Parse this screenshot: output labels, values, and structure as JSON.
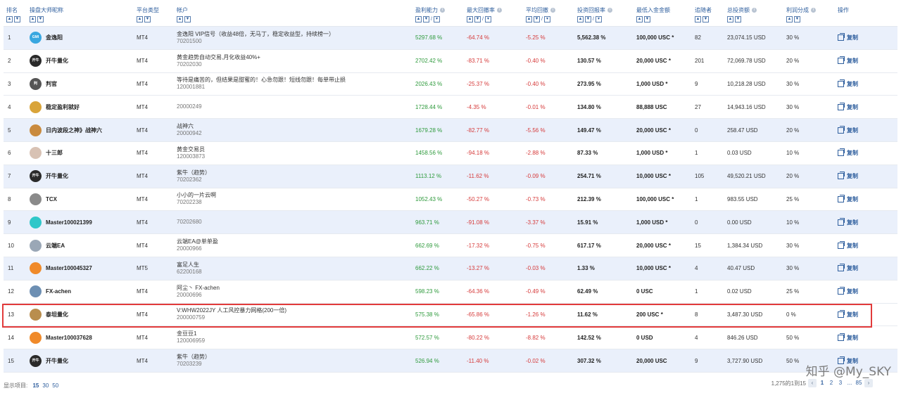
{
  "headers": [
    {
      "label": "排名",
      "info": false
    },
    {
      "label": "操盘大师昵称",
      "info": false
    },
    {
      "label": "平台类型",
      "info": false
    },
    {
      "label": "帐户",
      "info": false
    },
    {
      "label": "盈利能力",
      "info": true
    },
    {
      "label": "最大回撤率",
      "info": true
    },
    {
      "label": "平均回撤",
      "info": true
    },
    {
      "label": "投资回报率",
      "info": true
    },
    {
      "label": "最低入金金额",
      "info": false
    },
    {
      "label": "追随者",
      "info": false
    },
    {
      "label": "总投资额",
      "info": true
    },
    {
      "label": "利润分成",
      "info": true
    },
    {
      "label": "操作",
      "info": false
    }
  ],
  "info_glyph": "i",
  "copy_label": "复制",
  "star": "*",
  "colors": {
    "accent": "#2f5f9e",
    "positive": "#2e9a3c",
    "negative": "#d63a3a",
    "row_alt": "#eaf0fb",
    "highlight": "#e23b3b"
  },
  "rows": [
    {
      "rank": "1",
      "name": "金逸阳",
      "avatar_text": "GMI",
      "avatar_color": "#39a7e0",
      "platform": "MT4",
      "acct_title": "金逸阳 VIP信号（收益48倍，无马丁，稳定收益型，持续榜一）",
      "acct_id": "70201500",
      "profit": "5297.68 %",
      "max_dd": "-64.74 %",
      "avg_dd": "-5.25 %",
      "roi": "5,562.38 %",
      "min_dep": "100,000 USC",
      "min_star": true,
      "followers": "82",
      "total_inv": "23,074.15 USD",
      "share": "30 %",
      "alt": true
    },
    {
      "rank": "2",
      "name": "开牛量化",
      "avatar_text": "开牛",
      "avatar_color": "#2a2a2a",
      "platform": "MT4",
      "acct_title": "黄金趋势自动交易,月化收益40%+",
      "acct_id": "70202030",
      "profit": "2702.42 %",
      "max_dd": "-83.71 %",
      "avg_dd": "-0.40 %",
      "roi": "130.57 %",
      "min_dep": "20,000 USC",
      "min_star": true,
      "followers": "201",
      "total_inv": "72,069.78 USD",
      "share": "20 %",
      "alt": false
    },
    {
      "rank": "3",
      "name": "判官",
      "avatar_text": "判",
      "avatar_color": "#555555",
      "platform": "MT4",
      "acct_title": "等待是痛苦的，但结果是甜蜜的！心急勿跟！短线勿跟！每单带止损",
      "acct_id": "120001881",
      "profit": "2026.43 %",
      "max_dd": "-25.37 %",
      "avg_dd": "-0.40 %",
      "roi": "273.95 %",
      "min_dep": "1,000 USD",
      "min_star": true,
      "followers": "9",
      "total_inv": "10,218.28 USD",
      "share": "30 %",
      "alt": false
    },
    {
      "rank": "4",
      "name": "稳定盈利就好",
      "avatar_text": "",
      "avatar_color": "#d9a43a",
      "platform": "MT4",
      "acct_title": "",
      "acct_id": "20000249",
      "profit": "1728.44 %",
      "max_dd": "-4.35 %",
      "avg_dd": "-0.01 %",
      "roi": "134.80 %",
      "min_dep": "88,888 USC",
      "min_star": false,
      "followers": "27",
      "total_inv": "14,943.16 USD",
      "share": "30 %",
      "alt": false
    },
    {
      "rank": "5",
      "name": "日内波段之神》战神六",
      "avatar_text": "",
      "avatar_color": "#c98a3e",
      "platform": "MT4",
      "acct_title": "战神六",
      "acct_id": "20000942",
      "profit": "1679.28 %",
      "max_dd": "-82.77 %",
      "avg_dd": "-5.56 %",
      "roi": "149.47 %",
      "min_dep": "20,000 USC",
      "min_star": true,
      "followers": "0",
      "total_inv": "258.47 USD",
      "share": "20 %",
      "alt": true
    },
    {
      "rank": "6",
      "name": "十三郎",
      "avatar_text": "",
      "avatar_color": "#d8c2b4",
      "platform": "MT4",
      "acct_title": "黄金交易员",
      "acct_id": "120003873",
      "profit": "1458.56 %",
      "max_dd": "-94.18 %",
      "avg_dd": "-2.88 %",
      "roi": "87.33 %",
      "min_dep": "1,000 USD",
      "min_star": true,
      "followers": "1",
      "total_inv": "0.03 USD",
      "share": "10 %",
      "alt": false
    },
    {
      "rank": "7",
      "name": "开牛量化",
      "avatar_text": "开牛",
      "avatar_color": "#2a2a2a",
      "platform": "MT4",
      "acct_title": "紫牛（趋势）",
      "acct_id": "70202362",
      "profit": "1113.12 %",
      "max_dd": "-11.62 %",
      "avg_dd": "-0.09 %",
      "roi": "254.71 %",
      "min_dep": "10,000 USC",
      "min_star": true,
      "followers": "105",
      "total_inv": "49,520.21 USD",
      "share": "20 %",
      "alt": true
    },
    {
      "rank": "8",
      "name": "TCX",
      "avatar_text": "",
      "avatar_color": "#8a8a8a",
      "platform": "MT4",
      "acct_title": "小小的一片云啊",
      "acct_id": "70202238",
      "profit": "1052.43 %",
      "max_dd": "-50.27 %",
      "avg_dd": "-0.73 %",
      "roi": "212.39 %",
      "min_dep": "100,000 USC",
      "min_star": true,
      "followers": "1",
      "total_inv": "983.55 USD",
      "share": "25 %",
      "alt": false
    },
    {
      "rank": "9",
      "name": "Master100021399",
      "avatar_text": "",
      "avatar_color": "#2fc7c9",
      "platform": "MT4",
      "acct_title": "",
      "acct_id": "70202680",
      "profit": "963.71 %",
      "max_dd": "-91.08 %",
      "avg_dd": "-3.37 %",
      "roi": "15.91 %",
      "min_dep": "1,000 USD",
      "min_star": true,
      "followers": "0",
      "total_inv": "0.00 USD",
      "share": "10 %",
      "alt": true
    },
    {
      "rank": "10",
      "name": "云端EA",
      "avatar_text": "",
      "avatar_color": "#9aa7b6",
      "platform": "MT4",
      "acct_title": "云端EA@单单盈",
      "acct_id": "20000966",
      "profit": "662.69 %",
      "max_dd": "-17.32 %",
      "avg_dd": "-0.75 %",
      "roi": "617.17 %",
      "min_dep": "20,000 USC",
      "min_star": true,
      "followers": "15",
      "total_inv": "1,384.34 USD",
      "share": "30 %",
      "alt": false
    },
    {
      "rank": "11",
      "name": "Master100045327",
      "avatar_text": "",
      "avatar_color": "#f08a2a",
      "platform": "MT5",
      "acct_title": "富足人生",
      "acct_id": "62200168",
      "profit": "662.22 %",
      "max_dd": "-13.27 %",
      "avg_dd": "-0.03 %",
      "roi": "1.33 %",
      "min_dep": "10,000 USC",
      "min_star": true,
      "followers": "4",
      "total_inv": "40.47 USD",
      "share": "30 %",
      "alt": true
    },
    {
      "rank": "12",
      "name": "FX-achen",
      "avatar_text": "",
      "avatar_color": "#6d8fb3",
      "platform": "MT4",
      "acct_title": "阿尘丶 FX-achen",
      "acct_id": "20000696",
      "profit": "598.23 %",
      "max_dd": "-64.36 %",
      "avg_dd": "-0.49 %",
      "roi": "62.49 %",
      "min_dep": "0 USC",
      "min_star": false,
      "followers": "1",
      "total_inv": "0.02 USD",
      "share": "25 %",
      "alt": false
    },
    {
      "rank": "13",
      "name": "泰坦量化",
      "avatar_text": "",
      "avatar_color": "#b98e4e",
      "platform": "MT4",
      "acct_title": "V:WHW2022JY 人工风控暴力网格(200一倍)",
      "acct_id": "200000759",
      "profit": "575.38 %",
      "max_dd": "-65.86 %",
      "avg_dd": "-1.26 %",
      "roi": "11.62 %",
      "min_dep": "200 USC",
      "min_star": true,
      "followers": "8",
      "total_inv": "3,487.30 USD",
      "share": "0 %",
      "alt": false
    },
    {
      "rank": "14",
      "name": "Master100037628",
      "avatar_text": "",
      "avatar_color": "#f08a2a",
      "platform": "MT4",
      "acct_title": "金豆豆1",
      "acct_id": "120006959",
      "profit": "572.57 %",
      "max_dd": "-80.22 %",
      "avg_dd": "-8.82 %",
      "roi": "142.52 %",
      "min_dep": "0 USD",
      "min_star": false,
      "followers": "4",
      "total_inv": "846.26 USD",
      "share": "50 %",
      "alt": false
    },
    {
      "rank": "15",
      "name": "开牛量化",
      "avatar_text": "开牛",
      "avatar_color": "#2a2a2a",
      "platform": "MT4",
      "acct_title": "紫牛（趋势）",
      "acct_id": "70203239",
      "profit": "526.94 %",
      "max_dd": "-11.40 %",
      "avg_dd": "-0.02 %",
      "roi": "307.32 %",
      "min_dep": "20,000 USC",
      "min_star": false,
      "followers": "9",
      "total_inv": "3,727.90 USD",
      "share": "50 %",
      "alt": true
    }
  ],
  "footer": {
    "show_label": "显示项目:",
    "options": [
      "15",
      "30",
      "50"
    ],
    "active_option": "15",
    "range_text": "1,275的1到15",
    "prev": "‹",
    "pages": [
      "1",
      "2",
      "3",
      "...",
      "85"
    ],
    "next": "›"
  },
  "watermark": "知乎 @My_SKY"
}
